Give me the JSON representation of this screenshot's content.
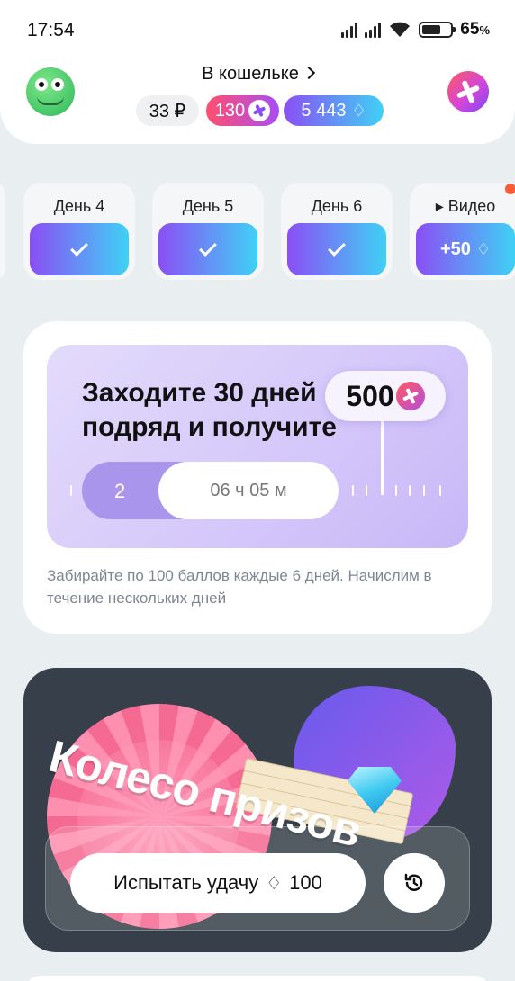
{
  "status_bar": {
    "time": "17:54",
    "battery_percent": "65",
    "battery_suffix": "%"
  },
  "header": {
    "wallet_title": "В кошельке",
    "rub_balance": "33 ₽",
    "plus_balance": "130",
    "gem_balance": "5 443"
  },
  "days": [
    {
      "label": "День 4",
      "state": "done"
    },
    {
      "label": "День 5",
      "state": "done"
    },
    {
      "label": "День 6",
      "state": "done"
    },
    {
      "label": "▸ Видео",
      "reward": "+50"
    }
  ],
  "streak": {
    "title_line1": "Заходите 30 дней",
    "title_line2": "подряд и получите",
    "reward": "500",
    "current_day": "2",
    "timer": "06 ч 05 м",
    "note": "Забирайте по 100 баллов каждые 6 дней. Начислим в течение нескольких дней"
  },
  "wheel": {
    "title": "Колесо призов",
    "try_label": "Испытать удачу",
    "try_cost": "100"
  },
  "colors": {
    "accent_gradient_start": "#8a4ff5",
    "accent_gradient_end": "#3fd1f5",
    "plus_gradient_start": "#ff4f6d",
    "plus_gradient_end": "#a94df5"
  }
}
